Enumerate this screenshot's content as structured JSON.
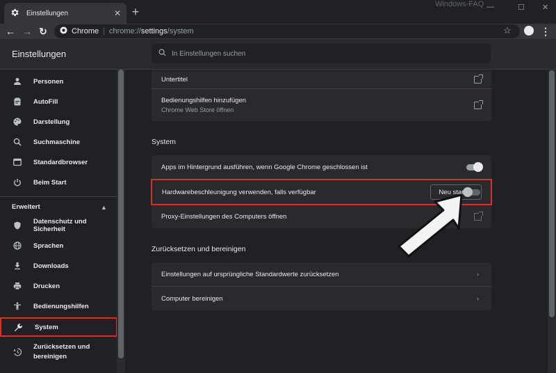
{
  "window": {
    "tab_title": "Einstellungen",
    "tab_close": "✕",
    "new_tab": "+",
    "watermark": "Windows-FAQ",
    "controls": [
      "—",
      "☐",
      "✕"
    ]
  },
  "toolbar": {
    "back": "←",
    "forward": "→",
    "reload": "↻",
    "site_name": "Chrome",
    "url_prefix": "chrome://",
    "url_host": "settings",
    "url_path": "/system",
    "star": "☆",
    "menu": "⋮"
  },
  "header": {
    "title": "Einstellungen",
    "search_placeholder": "In Einstellungen suchen"
  },
  "sidebar": {
    "items": [
      {
        "label": "Personen",
        "icon": "person-icon"
      },
      {
        "label": "AutoFill",
        "icon": "clipboard-icon"
      },
      {
        "label": "Darstellung",
        "icon": "palette-icon"
      },
      {
        "label": "Suchmaschine",
        "icon": "search-icon"
      },
      {
        "label": "Standardbrowser",
        "icon": "browser-icon"
      },
      {
        "label": "Beim Start",
        "icon": "power-icon"
      }
    ],
    "advanced_label": "Erweitert",
    "advanced_caret": "▲",
    "advanced_items": [
      {
        "label": "Datenschutz und Sicherheit",
        "icon": "shield-icon"
      },
      {
        "label": "Sprachen",
        "icon": "globe-icon"
      },
      {
        "label": "Downloads",
        "icon": "download-icon"
      },
      {
        "label": "Drucken",
        "icon": "printer-icon"
      },
      {
        "label": "Bedienungshilfen",
        "icon": "accessibility-icon"
      },
      {
        "label": "System",
        "icon": "wrench-icon",
        "selected": true
      },
      {
        "label": "Zurücksetzen und bereinigen",
        "icon": "history-icon"
      }
    ]
  },
  "accessibility": {
    "captions": "Untertitel",
    "add_features": "Bedienungshilfen hinzufügen",
    "add_features_sub": "Chrome Web Store öffnen"
  },
  "system": {
    "title": "System",
    "background_apps": "Apps im Hintergrund ausführen, wenn Google Chrome geschlossen ist",
    "background_apps_on": true,
    "hardware_accel": "Hardwarebeschleunigung verwenden, falls verfügbar",
    "hardware_accel_on": false,
    "relaunch": "Neu starten",
    "proxy": "Proxy-Einstellungen des Computers öffnen"
  },
  "reset": {
    "title": "Zurücksetzen und bereinigen",
    "restore": "Einstellungen auf ursprüngliche Standardwerte zurücksetzen",
    "cleanup": "Computer bereinigen",
    "chevron": "›"
  },
  "colors": {
    "highlight": "#d93025",
    "toggle_on_track": "#9aa0a6",
    "toggle_on_knob": "#e8eaed",
    "toggle_off_track": "#5f6368",
    "toggle_off_knob": "#bdc1c6"
  }
}
